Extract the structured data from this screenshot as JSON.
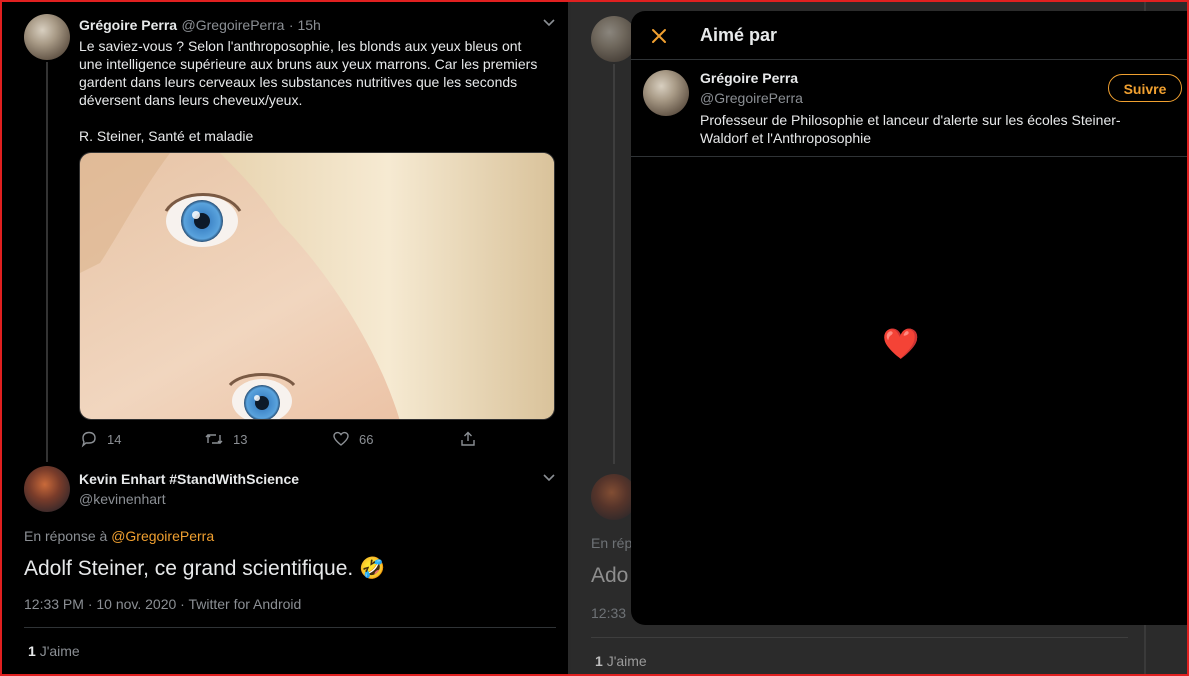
{
  "left": {
    "tweet1": {
      "author_name": "Grégoire Perra",
      "author_handle": "@GregoirePerra",
      "time": "· 15h",
      "text_lines": [
        "Le saviez-vous ? Selon l'anthroposophie, les blonds aux yeux bleus ont",
        "une intelligence supérieure aux bruns aux yeux marrons. Car les premiers",
        "gardent dans leurs cerveaux les substances nutritives que les seconds",
        "déversent dans leurs cheveux/yeux."
      ],
      "citation": "R. Steiner, Santé et maladie",
      "image_desc": "blue-eyes-photo",
      "replies": "14",
      "retweets": "13",
      "likes": "66"
    },
    "tweet2": {
      "author_name": "Kevin Enhart #StandWithScience",
      "author_handle": "@kevinenhart",
      "reply_prefix": "En réponse à",
      "reply_to": "@GregoirePerra",
      "text": "Adolf Steiner, ce grand scientifique.",
      "emoji": "🤣",
      "timestamp": "12:33 PM · 10 nov. 2020 · Twitter for Android",
      "likes_count": "1",
      "likes_label": "J'aime"
    }
  },
  "right_bg": {
    "reply_prefix_partial": "En rép",
    "text_partial": "Ado",
    "time_partial": "12:33",
    "likes_count": "1",
    "likes_label": "J'aime"
  },
  "modal": {
    "title": "Aimé par",
    "user": {
      "name": "Grégoire Perra",
      "handle": "@GregoirePerra",
      "bio_lines": [
        "Professeur de Philosophie et lanceur d'alerte sur les écoles Steiner-",
        "Waldorf et l'Anthroposophie"
      ],
      "follow_label": "Suivre"
    },
    "heart": "❤️"
  },
  "colors": {
    "accent": "#f0a030",
    "background": "#000000",
    "muted": "#8b8f94",
    "frame": "#e02020"
  }
}
